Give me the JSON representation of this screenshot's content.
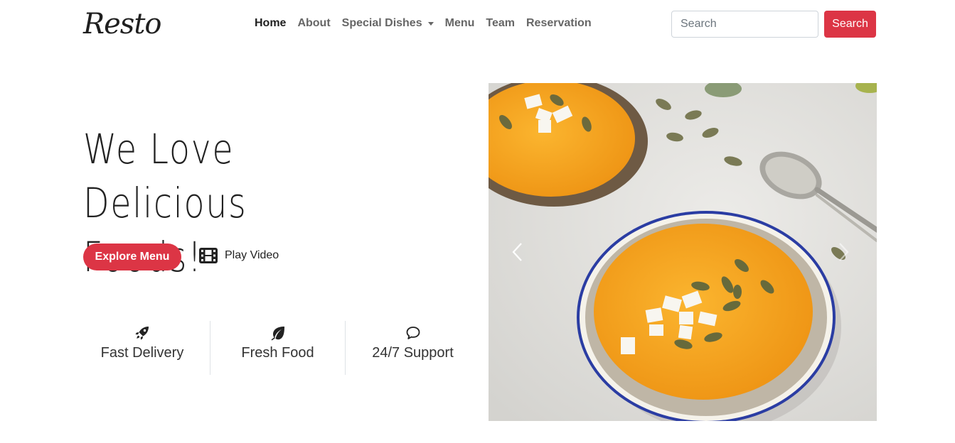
{
  "brand": {
    "logo_text": "Resto"
  },
  "nav": {
    "items": [
      {
        "label": "Home",
        "active": true
      },
      {
        "label": "About"
      },
      {
        "label": "Special Dishes",
        "dropdown": true
      },
      {
        "label": "Menu"
      },
      {
        "label": "Team"
      },
      {
        "label": "Reservation"
      }
    ]
  },
  "search": {
    "placeholder": "Search",
    "button_label": "Search"
  },
  "hero": {
    "title_line1": "We Love",
    "title_line2": "Delicious Foods!",
    "explore_label": "Explore Menu",
    "play_label": "Play Video"
  },
  "features": [
    {
      "label": "Fast Delivery",
      "icon": "rocket-icon"
    },
    {
      "label": "Fresh Food",
      "icon": "leaf-icon"
    },
    {
      "label": "24/7 Support",
      "icon": "chat-bubble-icon"
    }
  ],
  "colors": {
    "accent": "#dc3545",
    "text": "#212529",
    "soup": "#f5a321",
    "bowl_rim": "#2c3fa8"
  }
}
